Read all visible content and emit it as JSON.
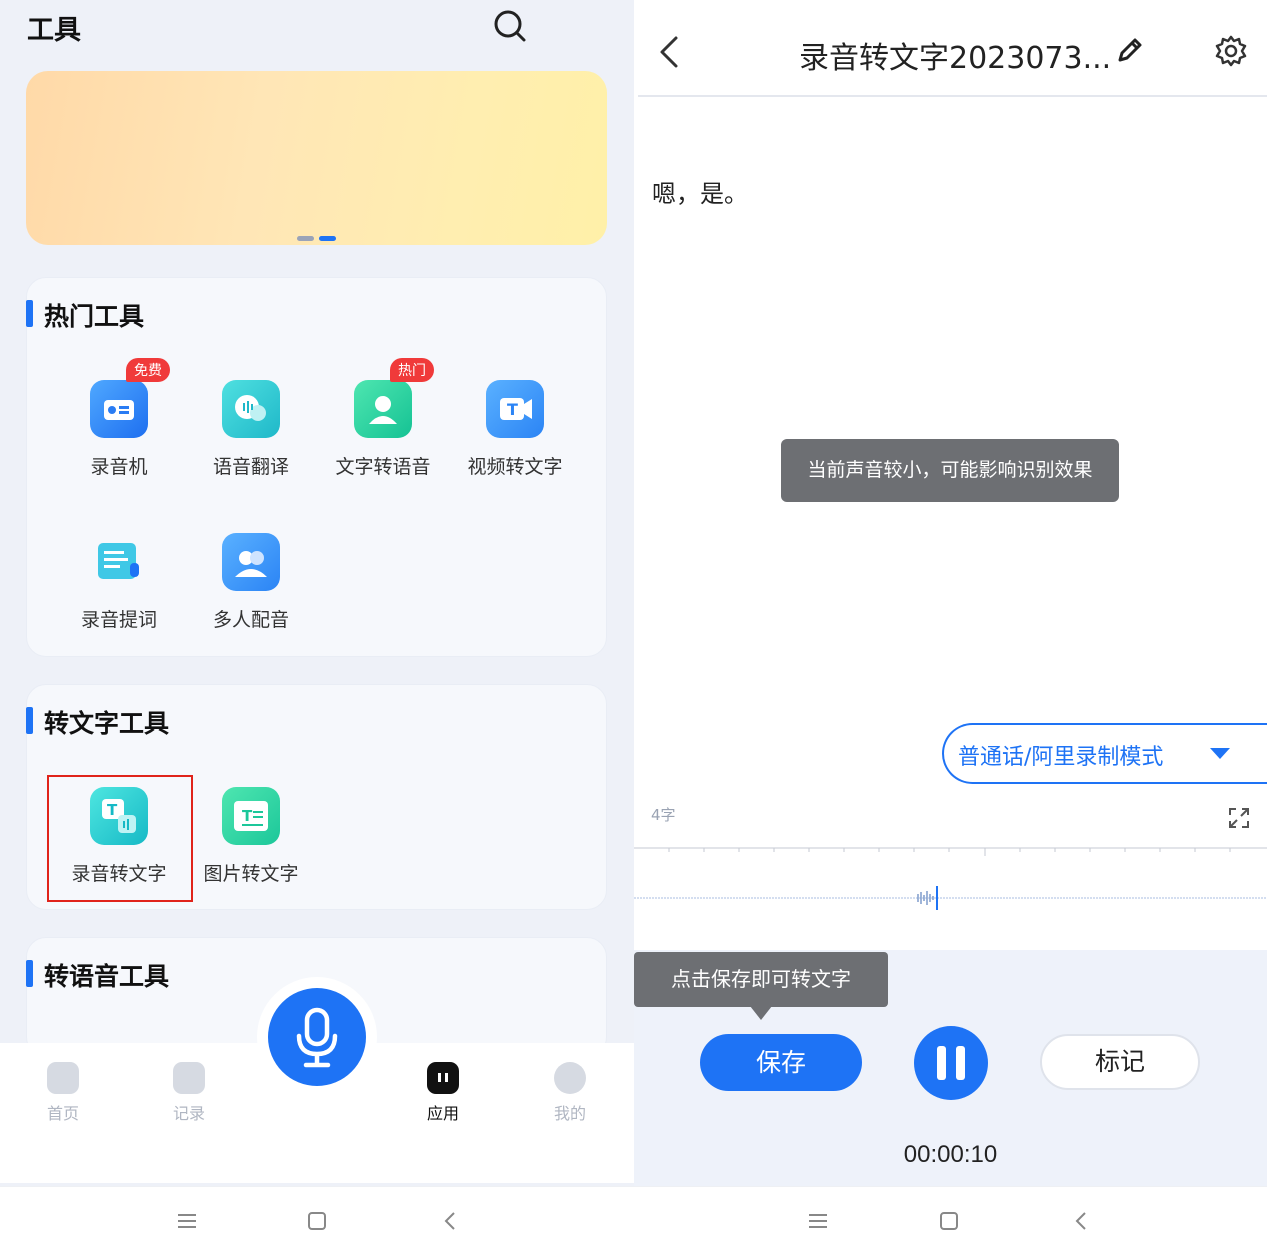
{
  "left": {
    "title": "工具",
    "hot_tools": {
      "title": "热门工具",
      "items": [
        {
          "label": "录音机",
          "badge": "免费"
        },
        {
          "label": "语音翻译"
        },
        {
          "label": "文字转语音",
          "badge": "热门"
        },
        {
          "label": "视频转文字"
        },
        {
          "label": "录音提词"
        },
        {
          "label": "多人配音"
        }
      ]
    },
    "text_tools": {
      "title": "转文字工具",
      "items": [
        {
          "label": "录音转文字"
        },
        {
          "label": "图片转文字"
        }
      ]
    },
    "voice_tools": {
      "title": "转语音工具"
    },
    "nav": [
      {
        "label": "首页"
      },
      {
        "label": "记录"
      },
      {
        "label": "应用"
      },
      {
        "label": "我的"
      }
    ],
    "active_nav": "应用"
  },
  "right": {
    "title": "录音转文字2023073...",
    "transcript": "嗯，是。",
    "toast": "当前声音较小，可能影响识别效果",
    "mode_label": "普通话/阿里录制模式",
    "word_count": "4字",
    "tip": "点击保存即可转文字",
    "save_label": "保存",
    "mark_label": "标记",
    "timer": "00:00:10"
  },
  "colors": {
    "accent": "#1e73f5",
    "badge_red": "#f03a3a",
    "highlight_box": "#e0231b",
    "toast_bg": "#6d6f73"
  }
}
